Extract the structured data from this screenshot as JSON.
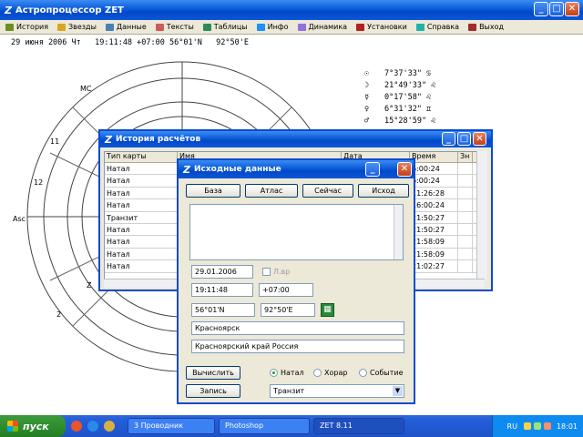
{
  "main": {
    "title": "Астропроцессор ZET",
    "menu": [
      {
        "label": "История",
        "icon": "history-icon",
        "color": "#6b8e23"
      },
      {
        "label": "Звезды",
        "icon": "stars-icon",
        "color": "#daa520"
      },
      {
        "label": "Данные",
        "icon": "data-icon",
        "color": "#4682b4"
      },
      {
        "label": "Тексты",
        "icon": "texts-icon",
        "color": "#cd5c5c"
      },
      {
        "label": "Таблицы",
        "icon": "tables-icon",
        "color": "#2e8b57"
      },
      {
        "label": "Инфо",
        "icon": "info-icon",
        "color": "#1e90ff"
      },
      {
        "label": "Динамика",
        "icon": "dynamics-icon",
        "color": "#9370db"
      },
      {
        "label": "Установки",
        "icon": "settings-icon",
        "color": "#b22222"
      },
      {
        "label": "Справка",
        "icon": "help-icon",
        "color": "#20b2aa"
      },
      {
        "label": "Выход",
        "icon": "exit-icon",
        "color": "#a52a2a"
      }
    ],
    "info_line": "29 июня 2006 Чт   19:11:48 +07:00 56°01'N   92°50'E",
    "chart_labels": [
      "11",
      "12",
      "Asc",
      "2",
      "Z",
      "MC"
    ],
    "planets": [
      {
        "symbol": "☉",
        "pos": "7°37'33\" ♋"
      },
      {
        "symbol": "☽",
        "pos": "21°49'33\" ♌"
      },
      {
        "symbol": "☿",
        "pos": "0°17'58\" ♌"
      },
      {
        "symbol": "♀",
        "pos": "6°31'32\" ♊"
      },
      {
        "symbol": "♂",
        "pos": "15°28'59\" ♌"
      }
    ]
  },
  "history": {
    "title": "История расчётов",
    "columns": [
      "Тип карты",
      "Имя",
      "Дата",
      "Время",
      "Зн"
    ],
    "rows": [
      {
        "type": "Натал",
        "date": "",
        "time": "6:00:24"
      },
      {
        "type": "Натал",
        "date": "",
        "time": "6:00:24"
      },
      {
        "type": "Натал",
        "date": "",
        "time": "11:26:28"
      },
      {
        "type": "Натал",
        "date": "",
        "time": "16:00:24"
      },
      {
        "type": "Транзит",
        "date": "",
        "time": "21:50:27"
      },
      {
        "type": "Натал",
        "date": "",
        "time": "21:50:27"
      },
      {
        "type": "Натал",
        "date": "",
        "time": "21:58:09"
      },
      {
        "type": "Натал",
        "date": "",
        "time": "21:58:09"
      },
      {
        "type": "Натал",
        "date": "",
        "time": "21:02:27"
      }
    ]
  },
  "dialog": {
    "title": "Исходные данные",
    "buttons": [
      "База",
      "Атлас",
      "Сейчас",
      "Исход"
    ],
    "date": "29.01.2006",
    "dst_label": "Л.вр",
    "time": "19:11:48",
    "tz": "+07:00",
    "lat": "56°01'N",
    "lon": "92°50'E",
    "city": "Красноярск",
    "region": "Красноярский край Россия",
    "calc_button": "Вычислить",
    "save_button": "Запись",
    "radios": [
      {
        "label": "Натал",
        "on": true
      },
      {
        "label": "Хорар",
        "on": false
      },
      {
        "label": "Событие",
        "on": false
      }
    ],
    "chart_type_select": "Транзит"
  },
  "taskbar": {
    "start": "пуск",
    "tasks": [
      "3 Проводник",
      "Photoshop",
      "ZET 8.11"
    ],
    "tray_lang": "RU",
    "clock": "18:01"
  }
}
